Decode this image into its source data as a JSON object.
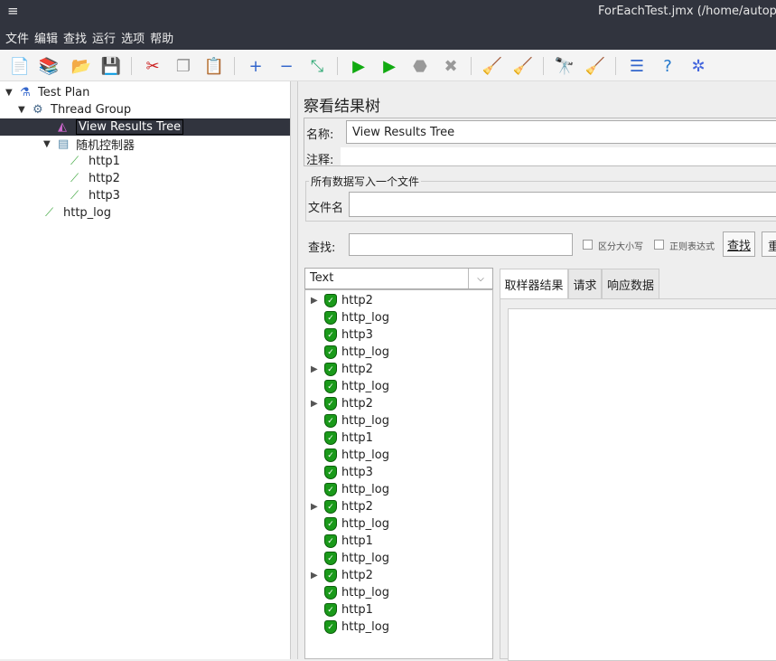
{
  "window": {
    "title": "ForEachTest.jmx (/home/autoph",
    "menu_icon": "≡"
  },
  "menu": [
    "文件",
    "编辑",
    "查找",
    "运行",
    "选项",
    "帮助"
  ],
  "toolbar": [
    {
      "name": "new-icon",
      "glyph": "📄"
    },
    {
      "name": "templates-icon",
      "glyph": "📚"
    },
    {
      "name": "open-icon",
      "glyph": "📂"
    },
    {
      "name": "save-icon",
      "glyph": "💾"
    },
    {
      "name": "cut-icon",
      "glyph": "✂"
    },
    {
      "name": "copy-icon",
      "glyph": "❐"
    },
    {
      "name": "paste-icon",
      "glyph": "📋"
    },
    {
      "name": "expand-icon",
      "glyph": "+"
    },
    {
      "name": "collapse-icon",
      "glyph": "−"
    },
    {
      "name": "toggle-icon",
      "glyph": "⤡"
    },
    {
      "name": "start-icon",
      "glyph": "▶"
    },
    {
      "name": "start-no-pause-icon",
      "glyph": "▶"
    },
    {
      "name": "stop-icon",
      "glyph": "⬣"
    },
    {
      "name": "shutdown-icon",
      "glyph": "✖"
    },
    {
      "name": "clear-icon",
      "glyph": "🧹"
    },
    {
      "name": "clear-all-icon",
      "glyph": "🧹"
    },
    {
      "name": "search-binoculars-icon",
      "glyph": "🔭"
    },
    {
      "name": "reset-search-broom-icon",
      "glyph": "🧹"
    },
    {
      "name": "function-helper-icon",
      "glyph": "☰"
    },
    {
      "name": "help-icon",
      "glyph": "?"
    },
    {
      "name": "remote-icon",
      "glyph": "✲"
    }
  ],
  "tree": [
    {
      "label": "Test Plan",
      "icon": "flask-icon",
      "level": 0,
      "toggle": "▼"
    },
    {
      "label": "Thread Group",
      "icon": "gear-icon",
      "level": 1,
      "toggle": "▼"
    },
    {
      "label": "View Results Tree",
      "icon": "chart-icon",
      "level": 2,
      "toggle": "",
      "selected": true
    },
    {
      "label": "随机控制器",
      "icon": "controller-icon",
      "level": 2,
      "toggle": "▼"
    },
    {
      "label": "http1",
      "icon": "pipette-icon",
      "level": 3,
      "toggle": ""
    },
    {
      "label": "http2",
      "icon": "pipette-icon",
      "level": 3,
      "toggle": ""
    },
    {
      "label": "http3",
      "icon": "pipette-icon",
      "level": 3,
      "toggle": ""
    },
    {
      "label": "http_log",
      "icon": "pipette-icon",
      "level": 2,
      "toggle": ""
    }
  ],
  "panel": {
    "title": "察看结果树",
    "name_label": "名称:",
    "name_value": "View Results Tree",
    "comment_label": "注释:",
    "comment_value": "",
    "file_group": "所有数据写入一个文件",
    "file_label": "文件名",
    "file_value": "",
    "search_label": "查找:",
    "search_value": "",
    "case_label": "区分大小写",
    "regex_label": "正则表达式",
    "find_button": "查找",
    "reset_button": "重",
    "renderer": "Text",
    "tabs": [
      "取样器结果",
      "请求",
      "响应数据"
    ]
  },
  "results": [
    {
      "label": "http2",
      "expandable": true
    },
    {
      "label": "http_log"
    },
    {
      "label": "http3"
    },
    {
      "label": "http_log"
    },
    {
      "label": "http2",
      "expandable": true
    },
    {
      "label": "http_log"
    },
    {
      "label": "http2",
      "expandable": true
    },
    {
      "label": "http_log"
    },
    {
      "label": "http1"
    },
    {
      "label": "http_log"
    },
    {
      "label": "http3"
    },
    {
      "label": "http_log"
    },
    {
      "label": "http2",
      "expandable": true
    },
    {
      "label": "http_log"
    },
    {
      "label": "http1"
    },
    {
      "label": "http_log"
    },
    {
      "label": "http2",
      "expandable": true
    },
    {
      "label": "http_log"
    },
    {
      "label": "http1"
    },
    {
      "label": "http_log"
    }
  ],
  "colors": {
    "titlebar": "#31343e",
    "selection": "#31343e",
    "success": "#1a9a1a"
  }
}
